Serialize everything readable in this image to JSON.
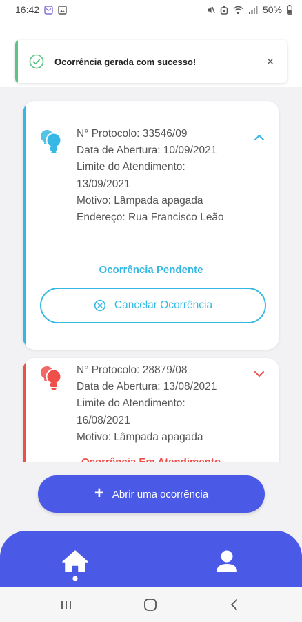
{
  "status_bar": {
    "time": "16:42",
    "battery": "50%"
  },
  "toast": {
    "message": "Ocorrência gerada com sucesso!",
    "close": "×"
  },
  "cards": [
    {
      "status": "Ocorrência Pendente",
      "color": "#35b8e3",
      "lines": [
        "N° Protocolo: 33546/09",
        "Data de Abertura: 10/09/2021",
        "Limite do Atendimento:",
        "13/09/2021",
        "Motivo: Lâmpada apagada",
        "Endereço: Rua Francisco Leão"
      ],
      "action_label": "Cancelar Ocorrência",
      "expanded": true
    },
    {
      "status": "Ocorrência Em Atendimento",
      "color": "#ef4f4b",
      "lines": [
        "N° Protocolo: 28879/08",
        "Data de Abertura: 13/08/2021",
        "Limite do Atendimento:",
        "16/08/2021",
        "Motivo: Lâmpada apagada"
      ],
      "expanded": false
    }
  ],
  "fab": {
    "label": "Abrir uma ocorrência"
  },
  "bottom_nav": {
    "items": [
      {
        "icon": "home-icon"
      },
      {
        "icon": "user-icon"
      }
    ]
  },
  "accent_color": "#4b5ae6"
}
